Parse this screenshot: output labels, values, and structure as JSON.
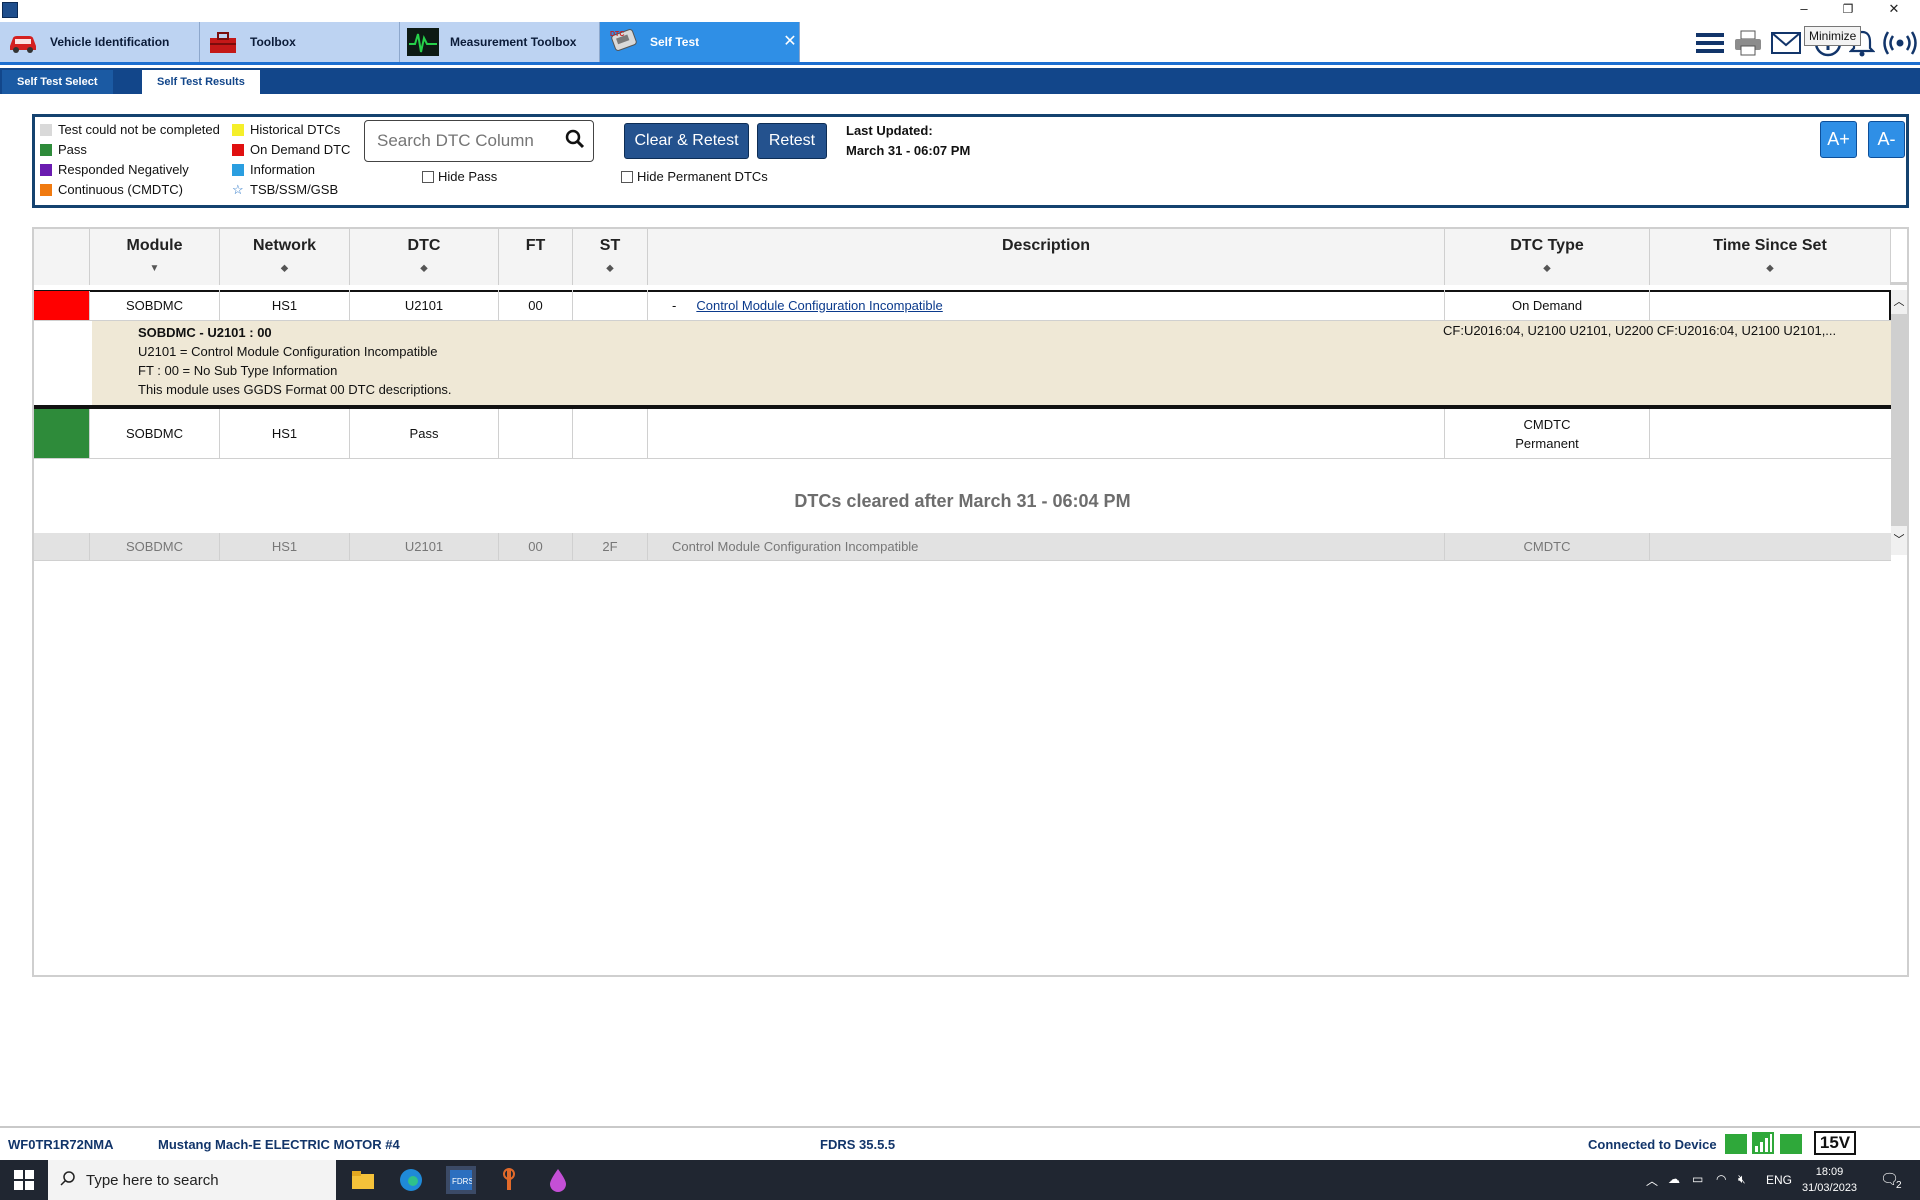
{
  "window": {
    "minimize_tooltip": "Minimize",
    "buttons": {
      "minimize": "–",
      "restore": "❐",
      "close": "✕"
    }
  },
  "main_tabs": [
    {
      "label": "Vehicle Identification",
      "icon": "car-icon"
    },
    {
      "label": "Toolbox",
      "icon": "toolbox-icon"
    },
    {
      "label": "Measurement Toolbox",
      "icon": "oscilloscope-icon"
    },
    {
      "label": "Self Test",
      "icon": "dtc-scanner-icon",
      "active": true
    }
  ],
  "toolbar_icons": [
    "menu-icon",
    "printer-icon",
    "mail-icon",
    "info-icon",
    "bell-icon",
    "wireless-icon"
  ],
  "sub_tabs": {
    "select": "Self Test Select",
    "results": "Self Test Results"
  },
  "legend": [
    {
      "label": "Test could not be completed",
      "color": "#d9d9d9"
    },
    {
      "label": "Pass",
      "color": "#2e8b3a"
    },
    {
      "label": "Responded Negatively",
      "color": "#6a1bb0"
    },
    {
      "label": "Continuous (CMDTC)",
      "color": "#f07a10"
    },
    {
      "label": "Historical DTCs",
      "color": "#f5ef2a"
    },
    {
      "label": "On Demand DTC",
      "color": "#e01010"
    },
    {
      "label": "Information",
      "color": "#2a9ee0"
    },
    {
      "label": "TSB/SSM/GSB",
      "color": "#1f6fc5"
    }
  ],
  "search": {
    "placeholder": "Search DTC Column"
  },
  "filters": {
    "hide_pass": "Hide Pass",
    "hide_permanent": "Hide Permanent DTCs"
  },
  "buttons": {
    "clear_retest": "Clear & Retest",
    "retest": "Retest",
    "font_up": "A+",
    "font_down": "A-"
  },
  "last_updated": {
    "label": "Last Updated:",
    "value": "March 31 - 06:07 PM"
  },
  "table": {
    "headers": [
      "Module",
      "Network",
      "DTC",
      "FT",
      "ST",
      "Description",
      "DTC Type",
      "Time Since Set"
    ],
    "sort_marks": [
      "▼",
      "⬥",
      "⬥",
      "",
      "⬥",
      "",
      "⬥",
      "⬥"
    ],
    "rows": [
      {
        "module": "SOBDMC",
        "network": "HS1",
        "dtc": "U2101",
        "ft": "00",
        "st": "",
        "expand": "-",
        "description": "Control Module Configuration Incompatible",
        "dtc_type": "On Demand",
        "time": "",
        "status_color": "#ff0000"
      },
      {
        "module": "SOBDMC",
        "network": "HS1",
        "dtc": "Pass",
        "ft": "",
        "st": "",
        "description": "",
        "dtc_type_1": "CMDTC",
        "dtc_type_2": "Permanent",
        "time": "",
        "status_color": "#2e8b3a"
      }
    ],
    "detail": {
      "title": "SOBDMC - U2101 : 00",
      "lines": [
        "U2101 = Control Module Configuration Incompatible",
        "FT : 00 = No Sub Type Information",
        "This module uses GGDS Format 00 DTC descriptions."
      ],
      "cf": "CF:U2016:04, U2100 U2101, U2200 CF:U2016:04, U2100 U2101,..."
    },
    "cleared_text": "DTCs cleared after  March 31 - 06:04 PM",
    "cleared_row": {
      "module": "SOBDMC",
      "network": "HS1",
      "dtc": "U2101",
      "ft": "00",
      "st": "2F",
      "description": "Control Module Configuration Incompatible",
      "dtc_type": "CMDTC",
      "time": ""
    }
  },
  "status": {
    "vin": "WF0TR1R72NMA",
    "vehicle": "Mustang Mach-E ELECTRIC MOTOR #4",
    "version": "FDRS 35.5.5",
    "connection": "Connected to Device",
    "voltage": "15V"
  },
  "taskbar": {
    "search_placeholder": "Type here to search",
    "lang": "ENG",
    "time": "18:09",
    "date": "31/03/2023",
    "notifications": "2"
  }
}
